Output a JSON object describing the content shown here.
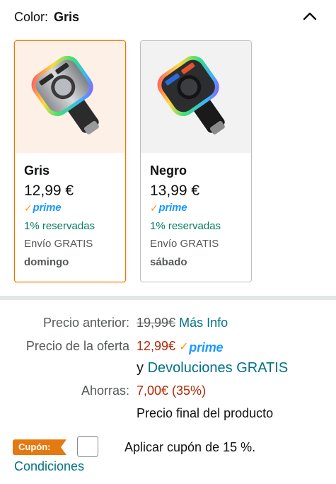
{
  "color_selector": {
    "label": "Color:",
    "selected": "Gris"
  },
  "variants": [
    {
      "name": "Gris",
      "price": "12,99 €",
      "prime": "prime",
      "reserved": "1% reservadas",
      "shipping": "Envío GRATIS",
      "delivery_day": "domingo",
      "selected": true
    },
    {
      "name": "Negro",
      "price": "13,99 €",
      "prime": "prime",
      "reserved": "1% reservadas",
      "shipping": "Envío GRATIS",
      "delivery_day": "sábado",
      "selected": false
    }
  ],
  "pricing": {
    "previous_label": "Precio anterior:",
    "previous_value": "19,99€",
    "more_info": "Más Info",
    "offer_label": "Precio de la oferta",
    "offer_value": "12,99€",
    "prime": "prime",
    "returns_prefix": "y",
    "returns_link": "Devoluciones GRATIS",
    "savings_label": "Ahorras:",
    "savings_value": "7,00€ (35%)",
    "final_price_note": "Precio final del producto"
  },
  "coupon": {
    "badge": "Cupón:",
    "apply_text": "Aplicar cupón de 15 %.",
    "checked": false,
    "conditions_link": "Condiciones"
  },
  "colors": {
    "accent_orange": "#e77600",
    "prime_blue": "#1a98ff",
    "green": "#067d62",
    "price_red": "#b12704",
    "link_teal": "#007185"
  }
}
